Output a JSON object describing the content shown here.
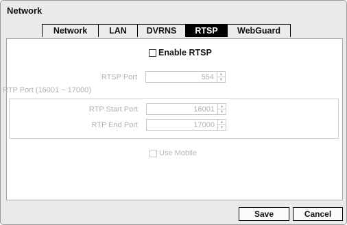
{
  "window": {
    "title": "Network"
  },
  "tabs": [
    {
      "label": "Network",
      "active": false
    },
    {
      "label": "LAN",
      "active": false
    },
    {
      "label": "DVRNS",
      "active": false
    },
    {
      "label": "RTSP",
      "active": true
    },
    {
      "label": "WebGuard",
      "active": false
    }
  ],
  "rtsp": {
    "enable_label": "Enable RTSP",
    "enable_checked": false,
    "port_label": "RTSP Port",
    "port_value": "554",
    "rtp_range_label": "RTP Port (16001 ~ 17000)",
    "rtp_start_label": "RTP Start Port",
    "rtp_start_value": "16001",
    "rtp_end_label": "RTP End Port",
    "rtp_end_value": "17000",
    "use_mobile_label": "Use Mobile",
    "use_mobile_checked": false
  },
  "footer": {
    "save_label": "Save",
    "cancel_label": "Cancel"
  },
  "icons": {
    "spinner_up": "triangle-up-icon",
    "spinner_down": "triangle-down-icon"
  },
  "colors": {
    "active_tab_bg": "#000000",
    "active_tab_text": "#ffffff",
    "disabled_text": "#b0b0b0",
    "panel_bg": "#eaeaea"
  }
}
